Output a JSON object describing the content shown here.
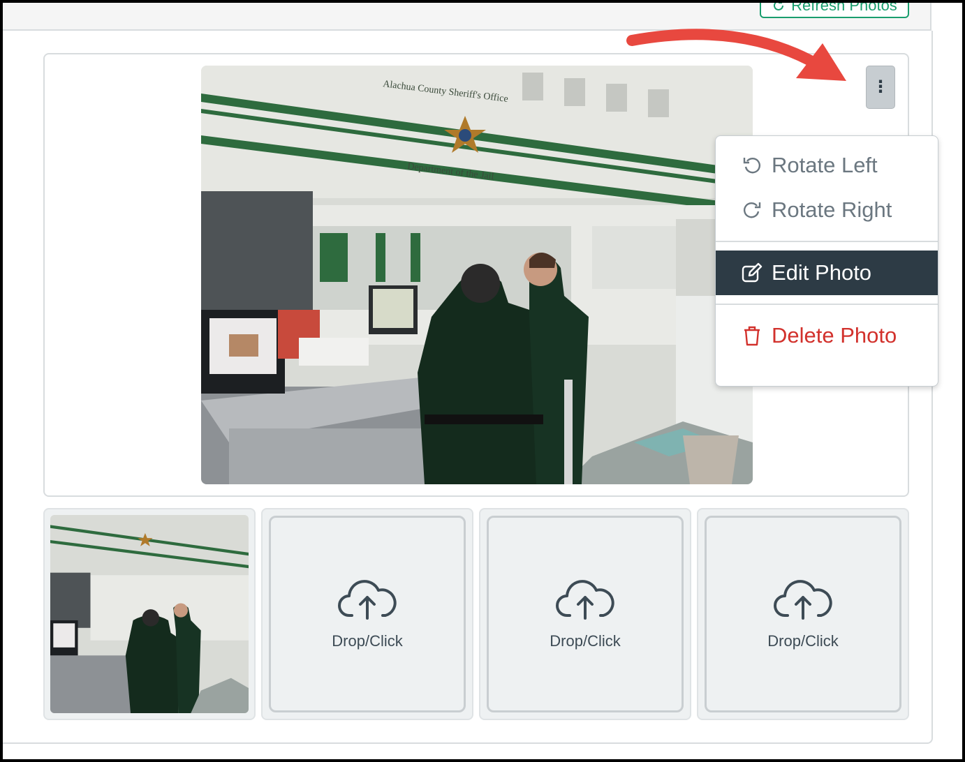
{
  "toolbar": {
    "refresh_label": "Refresh Photos"
  },
  "menu": {
    "rotate_left": "Rotate Left",
    "rotate_right": "Rotate Right",
    "edit_photo": "Edit Photo",
    "delete_photo": "Delete Photo"
  },
  "kebab": {
    "glyph": "⋮"
  },
  "dropzones": [
    {
      "label": "Drop/Click"
    },
    {
      "label": "Drop/Click"
    },
    {
      "label": "Drop/Click"
    }
  ],
  "photo": {
    "sign_line1": "Alachua County Sheriff's Office",
    "sign_line2": "Department of the Jail"
  },
  "colors": {
    "accent_green": "#1a9e6e",
    "menu_active_bg": "#2d3b45",
    "danger_red": "#d2312c",
    "annotation_arrow": "#e8483f"
  },
  "icons": {
    "refresh": "refresh-icon",
    "rotate_left": "rotate-left-icon",
    "rotate_right": "rotate-right-icon",
    "edit": "edit-icon",
    "delete": "trash-icon",
    "upload": "cloud-upload-icon",
    "more": "kebab-icon"
  }
}
